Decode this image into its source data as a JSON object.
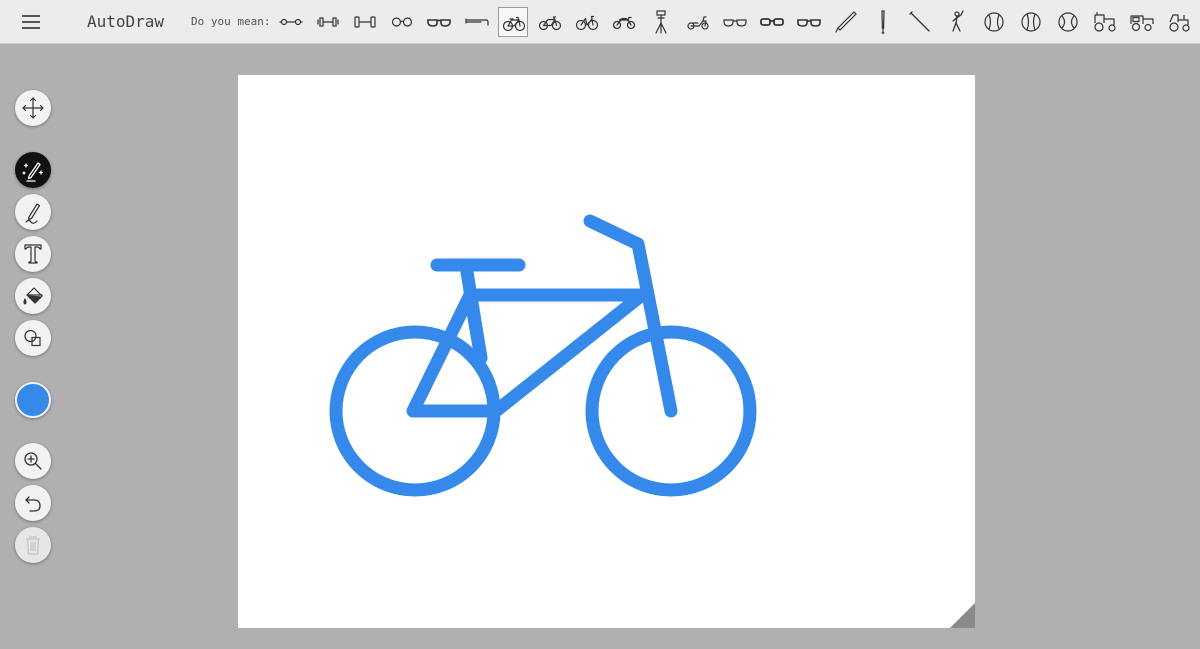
{
  "app": {
    "title": "AutoDraw"
  },
  "header": {
    "menu_icon": "hamburger-icon",
    "suggest_label": "Do you mean:",
    "suggestions": [
      "dumbbell-1",
      "dumbbell-2",
      "dumbbell-3",
      "eyeglasses-1",
      "sunglasses-1",
      "trombone",
      "bicycle-1",
      "bicycle-2",
      "bicycle-3",
      "motorcycle",
      "tripod",
      "scooter",
      "sunglasses-2",
      "eyeglasses-2",
      "eyeglasses-3",
      "baseball-bat-1",
      "baseball-bat-2",
      "baseball-bat-3",
      "baseball-player",
      "baseball-1",
      "baseball-2",
      "baseball-3",
      "tractor-1",
      "tractor-2",
      "tractor-3"
    ],
    "selected_suggestion": "bicycle-1"
  },
  "tools": {
    "move": "move-icon",
    "autodraw": "autodraw-icon",
    "draw": "pencil-icon",
    "text": "text-icon",
    "fill": "fill-bucket-icon",
    "shape": "shape-icon",
    "zoom": "zoom-in-icon",
    "undo": "undo-icon",
    "delete": "trash-icon",
    "active_tool": "autodraw"
  },
  "colors": {
    "current": "#3589eb",
    "canvas": "#ffffff",
    "background": "#b0b0b0",
    "topbar": "#ececec"
  },
  "canvas": {
    "drawing": "bicycle"
  }
}
